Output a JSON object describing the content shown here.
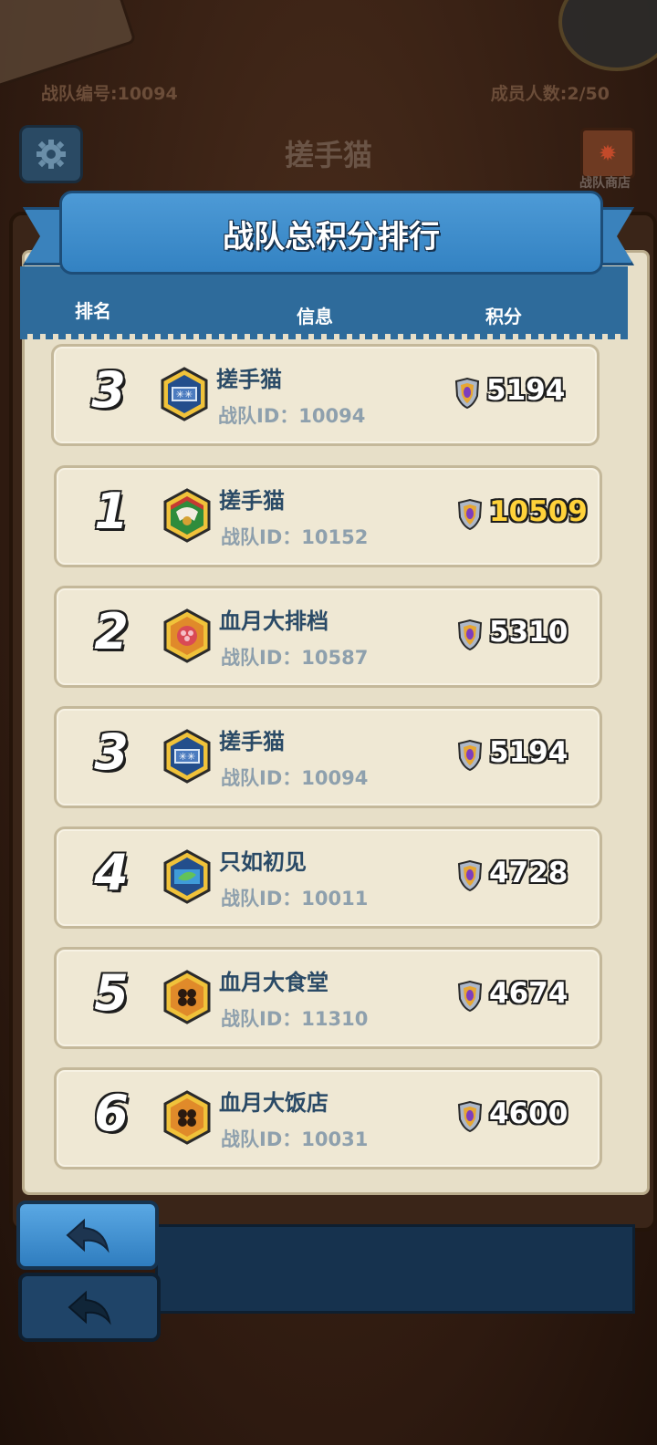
{
  "background": {
    "team_number": "战队编号:10094",
    "member_count": "成员人数:2/50",
    "team_title": "搓手猫",
    "shop_label": "战队商店"
  },
  "modal": {
    "title": "战队总积分排行",
    "columns": {
      "rank": "排名",
      "info": "信息",
      "score": "积分"
    }
  },
  "rows": [
    {
      "rank": "3",
      "name": "搓手猫",
      "id_label": "战队ID：10094",
      "score": "5194",
      "score_color": "#ffffff",
      "badge": "blue-snowflake-badge"
    },
    {
      "rank": "1",
      "name": "搓手猫",
      "id_label": "战队ID：10152",
      "score": "10509",
      "score_color": "#ffd23a",
      "badge": "red-green-badge"
    },
    {
      "rank": "2",
      "name": "血月大排档",
      "id_label": "战队ID：10587",
      "score": "5310",
      "score_color": "#ffffff",
      "badge": "orange-flower-badge"
    },
    {
      "rank": "3",
      "name": "搓手猫",
      "id_label": "战队ID：10094",
      "score": "5194",
      "score_color": "#ffffff",
      "badge": "blue-snowflake-badge"
    },
    {
      "rank": "4",
      "name": "只如初见",
      "id_label": "战队ID：10011",
      "score": "4728",
      "score_color": "#ffffff",
      "badge": "blue-leaf-badge"
    },
    {
      "rank": "5",
      "name": "血月大食堂",
      "id_label": "战队ID：11310",
      "score": "4674",
      "score_color": "#ffffff",
      "badge": "orange-clover-badge"
    },
    {
      "rank": "6",
      "name": "血月大饭店",
      "id_label": "战队ID：10031",
      "score": "4600",
      "score_color": "#ffffff",
      "badge": "orange-clover-badge"
    }
  ],
  "icons": {
    "settings": "gear-icon",
    "shop": "shop-icon",
    "score": "shield-score-icon",
    "back": "back-arrow-icon"
  }
}
